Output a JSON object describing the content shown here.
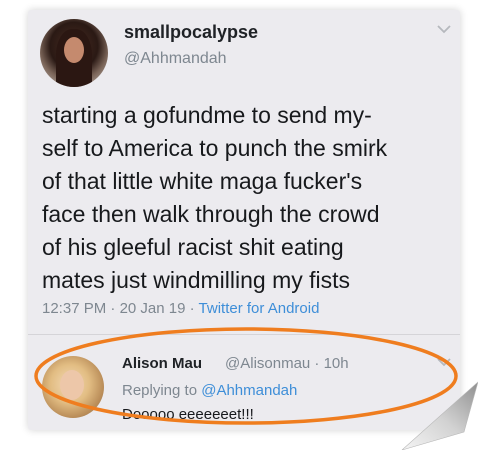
{
  "main_tweet": {
    "display_name": "smallpocalypse",
    "handle": "@Ahhmandah",
    "text": "starting a gofundme to send my-\nself to America to punch the smirk\nof that little white maga fucker's\nface then walk through the crowd\nof his gleeful racist shit eating\nmates just windmilling my fists",
    "time": "12:37 PM",
    "date": "20 Jan 19",
    "source": "Twitter for Android",
    "separator": "·"
  },
  "reply_tweet": {
    "display_name": "Alison Mau",
    "handle_time": "@Alisonmau · 10h",
    "replying_prefix": "Replying to",
    "replying_to": "@Ahhmandah",
    "text": "Dooooo eeeeeeet!!!"
  },
  "colors": {
    "background": "#ecebef",
    "link": "#3e8ed8",
    "muted": "#7e8790",
    "highlight": "#ef7d1f"
  },
  "icons": {
    "main_menu": "chevron-down-icon",
    "reply_menu": "chevron-down-icon",
    "curl": "page-curl-icon"
  }
}
